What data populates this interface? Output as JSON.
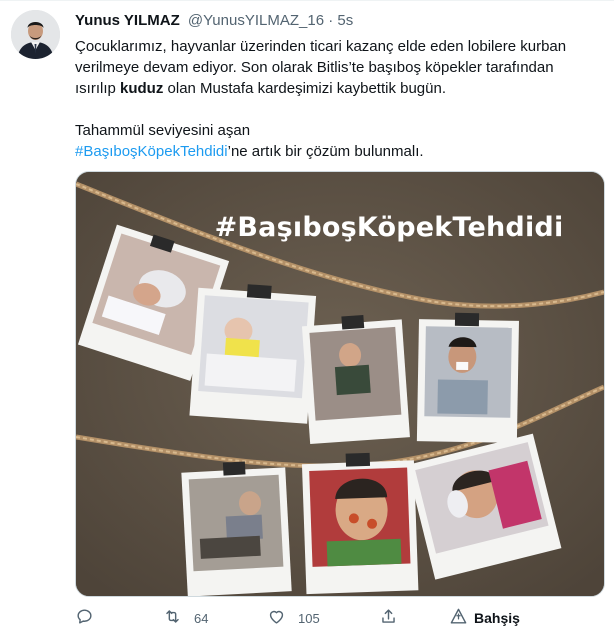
{
  "tweet": {
    "author_name": "Yunus YILMAZ",
    "author_handle": "@YunusYILMAZ_16",
    "separator": "·",
    "time": "5s",
    "text": {
      "line1": "Çocuklarımız, hayvanlar üzerinden ticari kazanç elde eden lobilere kurban",
      "line2": "verilmeye devam ediyor. Son olarak Bitlis’te başıboş köpekler tarafından",
      "line3_pre": "ısırılıp ",
      "line3_bold": "kuduz",
      "line3_post": " olan Mustafa kardeşimizi kaybettik bugün.",
      "line4": "Tahammül seviyesini aşan",
      "hashtag": "#BaşıboşKöpekTehdidi",
      "line5_post": "’ne artık bir çözüm bulunmalı."
    },
    "media": {
      "overlay_text": "#BaşıboşKöpekTehdidi",
      "background_color": "#5e5245",
      "polaroid_count": 7
    },
    "actions": {
      "reply": {
        "icon": "reply-icon",
        "count": ""
      },
      "retweet": {
        "icon": "retweet-icon",
        "count": "64"
      },
      "like": {
        "icon": "heart-icon",
        "count": "105"
      },
      "share": {
        "icon": "share-icon",
        "count": ""
      },
      "tip": {
        "icon": "tip-jar-icon",
        "label": "Bahşiş"
      }
    },
    "colors": {
      "accent": "#1d9bf0",
      "text": "#0f1419",
      "secondary": "#536471"
    }
  }
}
